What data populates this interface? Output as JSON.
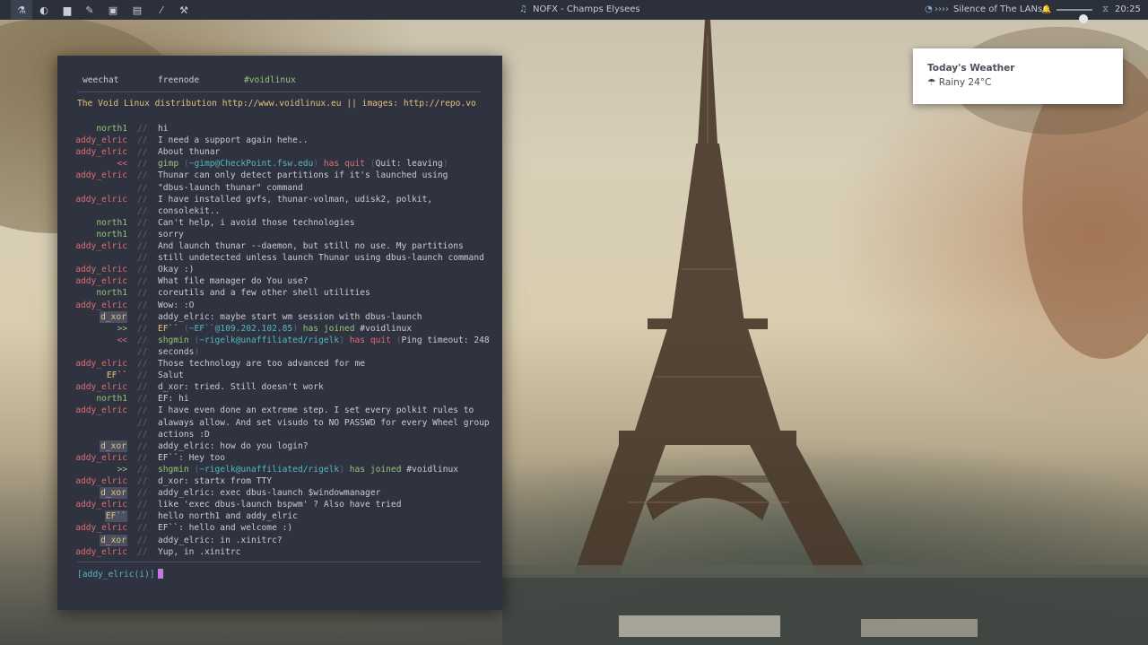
{
  "topbar": {
    "workspaces": [
      {
        "icon": "flask-icon",
        "glyph": "⚗",
        "active": true
      },
      {
        "icon": "firefox-icon",
        "glyph": "◐",
        "active": false
      },
      {
        "icon": "folder-icon",
        "glyph": "▆",
        "active": false
      },
      {
        "icon": "pencil-icon",
        "glyph": "✎",
        "active": false
      },
      {
        "icon": "image-icon",
        "glyph": "▣",
        "active": false
      },
      {
        "icon": "film-icon",
        "glyph": "▤",
        "active": false
      },
      {
        "icon": "brush-icon",
        "glyph": "⁄",
        "active": false
      },
      {
        "icon": "wrench-icon",
        "glyph": "⚒",
        "active": false
      }
    ],
    "now_playing": "NOFX - Champs Elysees",
    "music_icon": "♫",
    "network_icon": "◔",
    "network_arrows": "››››",
    "network_name": "Silence of The LANs",
    "bell_icon": "🔔",
    "volume_level": 0.75,
    "clock_icon": "⧖",
    "time": "20:25"
  },
  "terminal": {
    "tabs": [
      "weechat",
      "freenode",
      "#voidlinux"
    ],
    "topic": "The Void Linux distribution http://www.voidlinux.eu || images: http://repo.vo",
    "topic_more": ">>",
    "separator": "//",
    "lines": [
      {
        "nick": "north1",
        "nick_color": "green",
        "parts": [
          {
            "t": "hi",
            "c": "text"
          }
        ]
      },
      {
        "nick": "addy_elric",
        "nick_color": "red",
        "parts": [
          {
            "t": "I need a support again hehe..",
            "c": "text"
          }
        ]
      },
      {
        "nick": "addy_elric",
        "nick_color": "red",
        "parts": [
          {
            "t": "About thunar",
            "c": "text"
          }
        ]
      },
      {
        "nick": "<<",
        "nick_color": "red",
        "parts": [
          {
            "t": "gimp ",
            "c": "green"
          },
          {
            "t": "(",
            "c": "grey"
          },
          {
            "t": "~gimp@CheckPoint.fsw.edu",
            "c": "cyan"
          },
          {
            "t": ")",
            "c": "grey"
          },
          {
            "t": " has quit ",
            "c": "red"
          },
          {
            "t": "(",
            "c": "grey"
          },
          {
            "t": "Quit: leaving",
            "c": "text"
          },
          {
            "t": ")",
            "c": "grey"
          }
        ]
      },
      {
        "nick": "addy_elric",
        "nick_color": "red",
        "parts": [
          {
            "t": "Thunar can only detect partitions if it's launched using",
            "c": "text"
          }
        ]
      },
      {
        "nick": "",
        "nick_color": "red",
        "parts": [
          {
            "t": "\"dbus-launch thunar\" command",
            "c": "text"
          }
        ]
      },
      {
        "nick": "addy_elric",
        "nick_color": "red",
        "parts": [
          {
            "t": "I have installed gvfs, thunar-volman, udisk2, polkit,",
            "c": "text"
          }
        ]
      },
      {
        "nick": "",
        "nick_color": "red",
        "parts": [
          {
            "t": "consolekit..",
            "c": "text"
          }
        ]
      },
      {
        "nick": "north1",
        "nick_color": "green",
        "parts": [
          {
            "t": "Can't help, i avoid those technologies",
            "c": "text"
          }
        ]
      },
      {
        "nick": "north1",
        "nick_color": "green",
        "parts": [
          {
            "t": "sorry",
            "c": "text"
          }
        ]
      },
      {
        "nick": "addy_elric",
        "nick_color": "red",
        "parts": [
          {
            "t": "And launch thunar --daemon, but still no use. My partitions",
            "c": "text"
          }
        ]
      },
      {
        "nick": "",
        "nick_color": "red",
        "parts": [
          {
            "t": "still undetected unless launch Thunar using dbus-launch command",
            "c": "text"
          }
        ]
      },
      {
        "nick": "addy_elric",
        "nick_color": "red",
        "parts": [
          {
            "t": "Okay :)",
            "c": "text"
          }
        ]
      },
      {
        "nick": "addy_elric",
        "nick_color": "red",
        "parts": [
          {
            "t": "What file manager do You use?",
            "c": "text"
          }
        ]
      },
      {
        "nick": "north1",
        "nick_color": "green",
        "parts": [
          {
            "t": "coreutils and a few other shell utilities",
            "c": "text"
          }
        ]
      },
      {
        "nick": "addy_elric",
        "nick_color": "red",
        "parts": [
          {
            "t": "Wow: :O",
            "c": "text"
          }
        ]
      },
      {
        "nick": "d_xor",
        "nick_color": "hl",
        "parts": [
          {
            "t": "addy_elric: maybe start wm session with dbus-launch",
            "c": "text"
          }
        ]
      },
      {
        "nick": ">>",
        "nick_color": "green",
        "parts": [
          {
            "t": "EF``",
            "c": "yellow"
          },
          {
            "t": " (",
            "c": "grey"
          },
          {
            "t": "~EF``",
            "c": "cyan"
          },
          {
            "t": "@109.202.102.85",
            "c": "cyan"
          },
          {
            "t": ")",
            "c": "grey"
          },
          {
            "t": " has joined ",
            "c": "green"
          },
          {
            "t": "#voidlinux",
            "c": "text"
          }
        ]
      },
      {
        "nick": "<<",
        "nick_color": "red",
        "parts": [
          {
            "t": "shgmin ",
            "c": "green"
          },
          {
            "t": "(",
            "c": "grey"
          },
          {
            "t": "~rigelk@unaffiliated/rigelk",
            "c": "cyan"
          },
          {
            "t": ")",
            "c": "grey"
          },
          {
            "t": " has quit ",
            "c": "red"
          },
          {
            "t": "(",
            "c": "grey"
          },
          {
            "t": "Ping timeout: 248",
            "c": "text"
          }
        ]
      },
      {
        "nick": "",
        "nick_color": "red",
        "parts": [
          {
            "t": "seconds",
            "c": "text"
          },
          {
            "t": ")",
            "c": "grey"
          }
        ]
      },
      {
        "nick": "addy_elric",
        "nick_color": "red",
        "parts": [
          {
            "t": "Those technology are too advanced for me",
            "c": "text"
          }
        ]
      },
      {
        "nick": "EF``",
        "nick_color": "yellow",
        "parts": [
          {
            "t": "Salut",
            "c": "text"
          }
        ]
      },
      {
        "nick": "addy_elric",
        "nick_color": "red",
        "parts": [
          {
            "t": "d_xor: tried. Still doesn't work",
            "c": "text"
          }
        ]
      },
      {
        "nick": "north1",
        "nick_color": "green",
        "parts": [
          {
            "t": "EF: hi",
            "c": "text"
          }
        ]
      },
      {
        "nick": "addy_elric",
        "nick_color": "red",
        "parts": [
          {
            "t": "I have even done an extreme step. I set every polkit rules to",
            "c": "text"
          }
        ]
      },
      {
        "nick": "",
        "nick_color": "red",
        "parts": [
          {
            "t": "alaways allow. And set visudo to NO PASSWD for every Wheel group",
            "c": "text"
          }
        ]
      },
      {
        "nick": "",
        "nick_color": "red",
        "parts": [
          {
            "t": "actions :D",
            "c": "text"
          }
        ]
      },
      {
        "nick": "d_xor",
        "nick_color": "hl",
        "parts": [
          {
            "t": "addy_elric: how do you login?",
            "c": "text"
          }
        ]
      },
      {
        "nick": "addy_elric",
        "nick_color": "red",
        "parts": [
          {
            "t": "EF``: Hey too",
            "c": "text"
          }
        ]
      },
      {
        "nick": ">>",
        "nick_color": "green",
        "parts": [
          {
            "t": "shgmin ",
            "c": "green"
          },
          {
            "t": "(",
            "c": "grey"
          },
          {
            "t": "~rigelk@unaffiliated/rigelk",
            "c": "cyan"
          },
          {
            "t": ")",
            "c": "grey"
          },
          {
            "t": " has joined ",
            "c": "green"
          },
          {
            "t": "#voidlinux",
            "c": "text"
          }
        ]
      },
      {
        "nick": "addy_elric",
        "nick_color": "red",
        "parts": [
          {
            "t": "d_xor: startx from TTY",
            "c": "text"
          }
        ]
      },
      {
        "nick": "d_xor",
        "nick_color": "hl",
        "parts": [
          {
            "t": "addy_elric: exec dbus-launch $windowmanager",
            "c": "text"
          }
        ]
      },
      {
        "nick": "addy_elric",
        "nick_color": "red",
        "parts": [
          {
            "t": "like 'exec dbus-launch bspwm' ? Also have tried",
            "c": "text"
          }
        ]
      },
      {
        "nick": "EF``",
        "nick_color": "hl",
        "parts": [
          {
            "t": "hello north1 and addy_elric",
            "c": "text"
          }
        ]
      },
      {
        "nick": "addy_elric",
        "nick_color": "red",
        "parts": [
          {
            "t": "EF``: hello and welcome :)",
            "c": "text"
          }
        ]
      },
      {
        "nick": "d_xor",
        "nick_color": "hl",
        "parts": [
          {
            "t": "addy_elric: in .xinitrc?",
            "c": "text"
          }
        ]
      },
      {
        "nick": "addy_elric",
        "nick_color": "red",
        "parts": [
          {
            "t": "Yup, in .xinitrc",
            "c": "text"
          }
        ]
      }
    ],
    "prompt": "[addy_elric(i)]"
  },
  "weather": {
    "title": "Today's Weather",
    "icon": "☂",
    "condition": "Rainy 24°C"
  },
  "colors": {
    "bar_bg": "#2b303b",
    "terminal_bg": "#2e333f",
    "red": "#e06c75",
    "green": "#98c379",
    "yellow": "#e5c07b",
    "cyan": "#56b6c2",
    "grey": "#5c6370",
    "text": "#c8ccd4"
  }
}
